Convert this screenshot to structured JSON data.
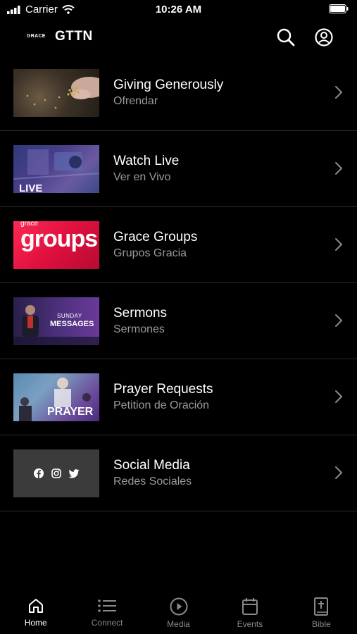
{
  "status_bar": {
    "carrier": "Carrier",
    "time": "10:26 AM"
  },
  "header": {
    "logo_text": "GRACE",
    "title": "GTTN"
  },
  "items": [
    {
      "title": "Giving Generously",
      "subtitle": "Ofrendar"
    },
    {
      "title": "Watch Live",
      "subtitle": "Ver en Vivo",
      "thumb_text": "LIVE"
    },
    {
      "title": "Grace Groups",
      "subtitle": "Grupos Gracia",
      "thumb_text_small": "grace",
      "thumb_text": "groups"
    },
    {
      "title": "Sermons",
      "subtitle": "Sermones",
      "thumb_text_small": "SUNDAY",
      "thumb_text": "MESSAGES"
    },
    {
      "title": "Prayer Requests",
      "subtitle": "Petition de Oración",
      "thumb_text": "PRAYER"
    },
    {
      "title": "Social Media",
      "subtitle": "Redes Sociales"
    }
  ],
  "tabs": [
    {
      "label": "Home",
      "icon": "home-icon",
      "active": true
    },
    {
      "label": "Connect",
      "icon": "list-icon"
    },
    {
      "label": "Media",
      "icon": "play-icon"
    },
    {
      "label": "Events",
      "icon": "calendar-icon"
    },
    {
      "label": "Bible",
      "icon": "bible-icon"
    }
  ]
}
